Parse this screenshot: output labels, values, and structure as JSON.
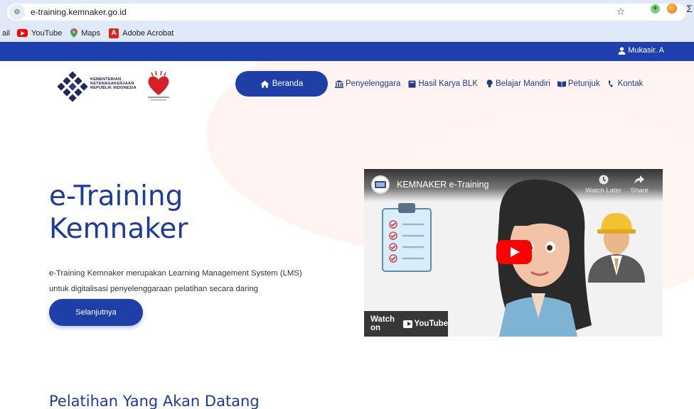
{
  "browser": {
    "url": "e-training.kemnaker.go.id",
    "bookmarks": [
      {
        "label": "ail"
      },
      {
        "label": "YouTube"
      },
      {
        "label": "Maps"
      },
      {
        "label": "Adobe Acrobat"
      }
    ]
  },
  "topbar": {
    "user": "Mukasir. A"
  },
  "logo": {
    "ministry_text": [
      "KEMENTERIAN",
      "KETENAGAKERJAAN",
      "REPUBLIK INDONESIA"
    ]
  },
  "nav": {
    "items": [
      {
        "label": "Beranda",
        "icon": "home-icon",
        "active": true
      },
      {
        "label": "Penyelenggara",
        "icon": "institution-icon"
      },
      {
        "label": "Hasil Karya BLK",
        "icon": "book-icon"
      },
      {
        "label": "Belajar Mandiri",
        "icon": "lightbulb-icon"
      },
      {
        "label": "Petunjuk",
        "icon": "open-book-icon"
      },
      {
        "label": "Kontak",
        "icon": "phone-icon"
      }
    ]
  },
  "hero": {
    "title_line1": "e-Training",
    "title_line2": "Kemnaker",
    "desc_line1": "e-Training Kemnaker merupakan Learning Management System (LMS)",
    "desc_line2": "untuk digitalisasi penyelenggaraan pelatihan secara daring",
    "cta": "Selanjutnya"
  },
  "video": {
    "title": "KEMNAKER e-Training",
    "watch_later": "Watch Later",
    "share": "Share",
    "watch_on": "Watch on",
    "youtube": "YouTube"
  },
  "upcoming": {
    "title": "Pelatihan Yang Akan Datang"
  },
  "colors": {
    "primary": "#1e3ea8",
    "topbar": "#1e40af",
    "text_heading": "#1e3a9c"
  }
}
